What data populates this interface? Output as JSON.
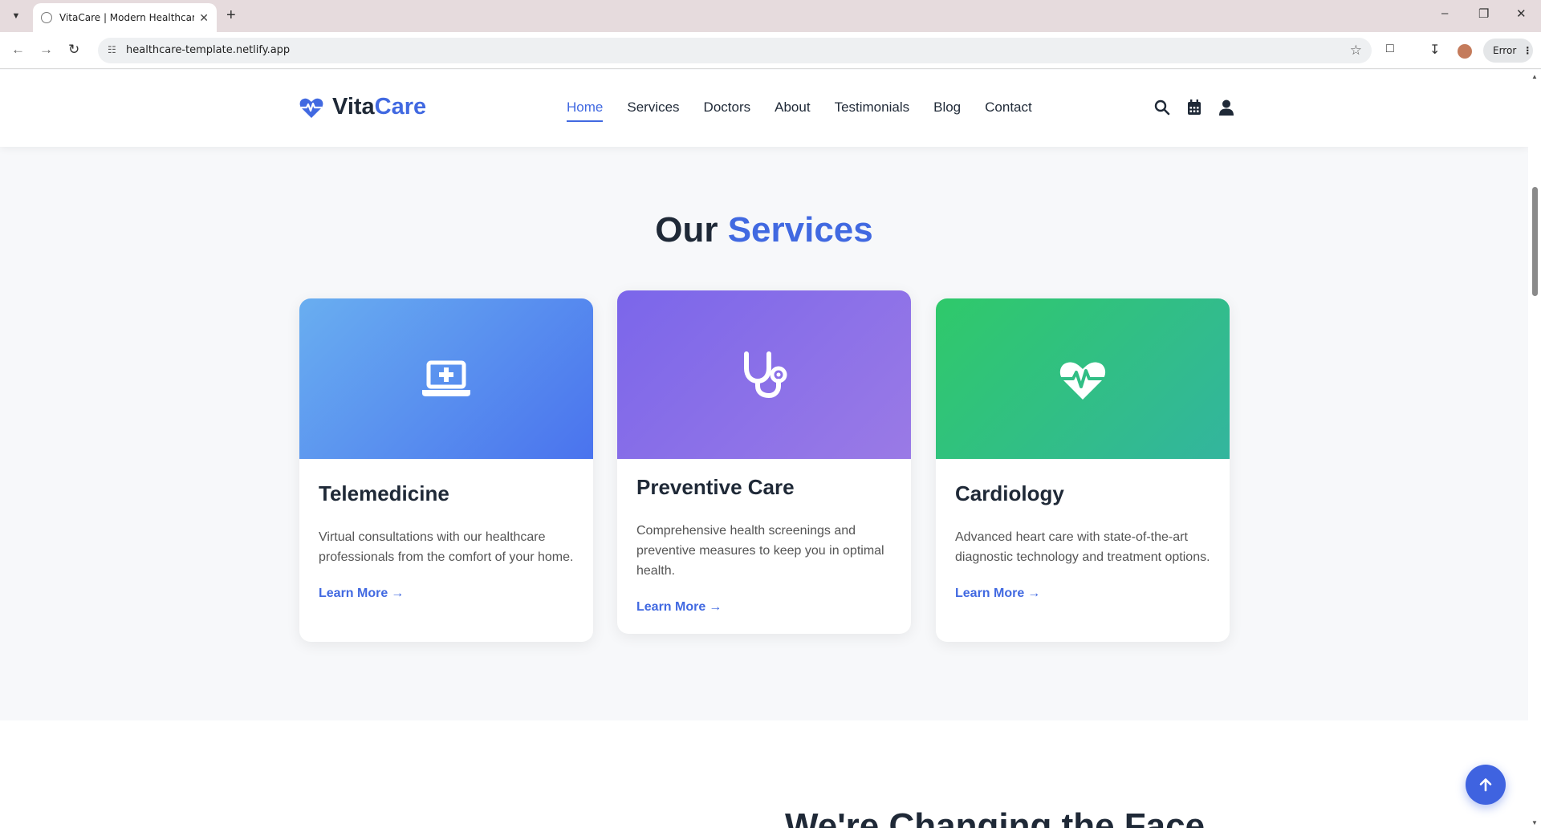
{
  "browser": {
    "tab_title": "VitaCare | Modern Healthcare S",
    "url": "healthcare-template.netlify.app",
    "error_label": "Error"
  },
  "site": {
    "logo_part1": "Vita",
    "logo_part2": "Care",
    "nav": [
      {
        "label": "Home",
        "active": true
      },
      {
        "label": "Services"
      },
      {
        "label": "Doctors"
      },
      {
        "label": "About"
      },
      {
        "label": "Testimonials"
      },
      {
        "label": "Blog"
      },
      {
        "label": "Contact"
      }
    ],
    "icons": [
      "search-icon",
      "calendar-icon",
      "user-icon"
    ]
  },
  "services": {
    "title_part1": "Our",
    "title_part2": "Services",
    "cards": [
      {
        "title": "Telemedicine",
        "text": "Virtual consultations with our healthcare professionals from the comfort of your home.",
        "link": "Learn More",
        "icon": "laptop-medical-icon",
        "color_from": "#69aef0",
        "color_to": "#4a73ee"
      },
      {
        "title": "Preventive Care",
        "text": "Comprehensive health screenings and preventive measures to keep you in optimal health.",
        "link": "Learn More",
        "icon": "stethoscope-icon",
        "color_from": "#7b66ea",
        "color_to": "#9a7ae6"
      },
      {
        "title": "Cardiology",
        "text": "Advanced heart care with state-of-the-art diagnostic technology and treatment options.",
        "link": "Learn More",
        "icon": "heart-pulse-icon",
        "color_from": "#2fc96a",
        "color_to": "#33b59e"
      }
    ]
  },
  "next_section": {
    "title": "We're Changing the Face"
  },
  "colors": {
    "accent": "#4169e1",
    "heading": "#1f2937"
  }
}
